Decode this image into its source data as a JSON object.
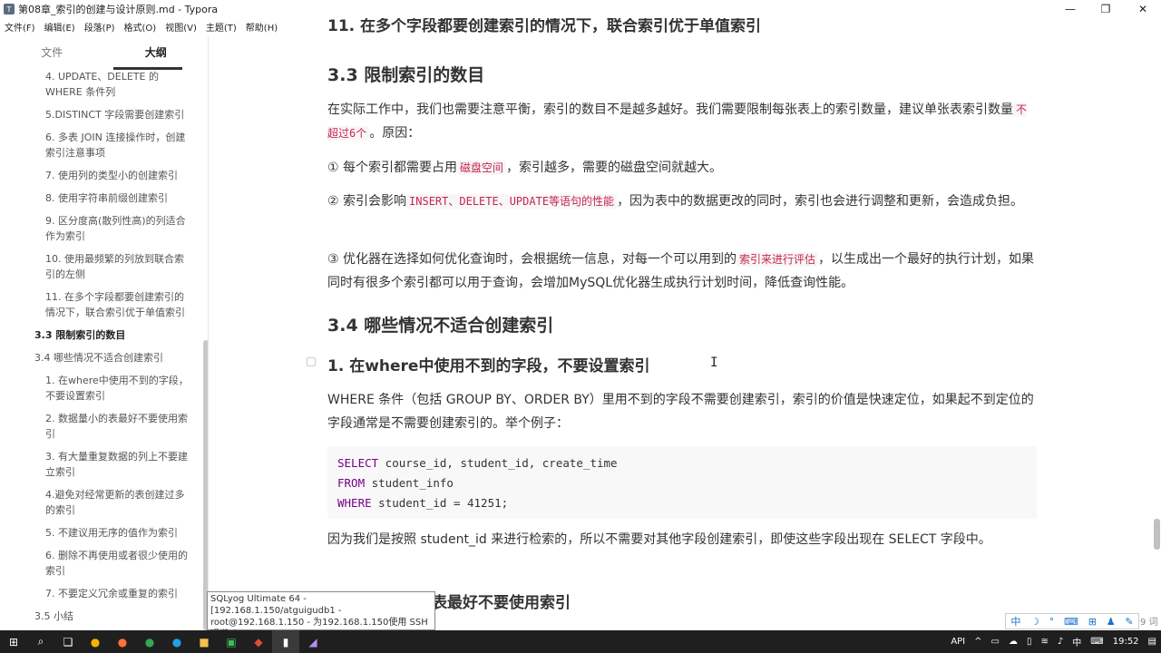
{
  "window": {
    "title": "第08章_索引的创建与设计原则.md - Typora",
    "controls": {
      "minimize": "—",
      "maximize": "❐",
      "close": "✕"
    }
  },
  "menu": [
    "文件(F)",
    "编辑(E)",
    "段落(P)",
    "格式(O)",
    "视图(V)",
    "主题(T)",
    "帮助(H)"
  ],
  "sidebar": {
    "tabs": [
      "文件",
      "大纲"
    ],
    "items": [
      {
        "text": "4. UPDATE、DELETE 的 WHERE 条件列",
        "level": 3,
        "bold": false
      },
      {
        "text": "5.DISTINCT 字段需要创建索引",
        "level": 3,
        "bold": false
      },
      {
        "text": "6. 多表 JOIN 连接操作时，创建索引注意事项",
        "level": 3,
        "bold": false
      },
      {
        "text": "7. 使用列的类型小的创建索引",
        "level": 3,
        "bold": false
      },
      {
        "text": "8. 使用字符串前缀创建索引",
        "level": 3,
        "bold": false
      },
      {
        "text": "9. 区分度高(散列性高)的列适合作为索引",
        "level": 3,
        "bold": false
      },
      {
        "text": "10. 使用最频繁的列放到联合索引的左侧",
        "level": 3,
        "bold": false
      },
      {
        "text": "11. 在多个字段都要创建索引的情况下，联合索引优于单值索引",
        "level": 3,
        "bold": false
      },
      {
        "text": "3.3 限制索引的数目",
        "level": 2,
        "bold": true
      },
      {
        "text": "3.4 哪些情况不适合创建索引",
        "level": 2,
        "bold": false
      },
      {
        "text": "1. 在where中使用不到的字段，不要设置索引",
        "level": 3,
        "bold": false
      },
      {
        "text": "2. 数据量小的表最好不要使用索引",
        "level": 3,
        "bold": false
      },
      {
        "text": "3. 有大量重复数据的列上不要建立索引",
        "level": 3,
        "bold": false
      },
      {
        "text": "4.避免对经常更新的表创建过多的索引",
        "level": 3,
        "bold": false
      },
      {
        "text": "5. 不建议用无序的值作为索引",
        "level": 3,
        "bold": false
      },
      {
        "text": "6. 删除不再使用或者很少使用的索引",
        "level": 3,
        "bold": false
      },
      {
        "text": "7. 不要定义冗余或重复的索引",
        "level": 3,
        "bold": false
      },
      {
        "text": "3.5 小结",
        "level": 2,
        "bold": false
      }
    ]
  },
  "doc": {
    "cut_heading": "11. 在多个字段都要创建索引的情况下，联合索引优于单值索引",
    "h_33": "3.3 限制索引的数目",
    "p1_a": "在实际工作中，我们也需要注意平衡，索引的数目不是越多越好。我们需要限制每张表上的索引数量，建议单张表索引数量",
    "p1_code": "不超过6个",
    "p1_b": "。原因：",
    "p2_a": "① 每个索引都需要占用",
    "p2_code": "磁盘空间",
    "p2_b": "，索引越多，需要的磁盘空间就越大。",
    "p3_a": "② 索引会影响",
    "p3_code": "INSERT、DELETE、UPDATE等语句的性能",
    "p3_b": "，因为表中的数据更改的同时，索引也会进行调整和更新，会造成负担。",
    "p4_a": "③ 优化器在选择如何优化查询时，会根据统一信息，对每一个可以用到的",
    "p4_code": "索引来进行评估",
    "p4_b": "，以生成出一个最好的执行计划，如果同时有很多个索引都可以用于查询，会增加MySQL优化器生成执行计划时间，降低查询性能。",
    "h_34": "3.4 哪些情况不适合创建索引",
    "h3_1": "1. 在where中使用不到的字段，不要设置索引",
    "p5": "WHERE 条件（包括 GROUP BY、ORDER BY）里用不到的字段不需要创建索引，索引的价值是快速定位，如果起不到定位的字段通常是不需要创建索引的。举个例子：",
    "code": [
      {
        "kw": "SELECT",
        "rest": " course_id, student_id, create_time"
      },
      {
        "kw": "FROM",
        "rest": " student_info"
      },
      {
        "kw": "WHERE",
        "rest": " student_id = 41251;"
      }
    ],
    "p6": "因为我们是按照 student_id 来进行检索的，所以不需要对其他字段创建索引，即使这些字段出现在 SELECT 字段中。",
    "h3_2_visible": "表最好不要使用索引"
  },
  "tooltip": "SQLyog Ultimate 64 - [192.168.1.150/atguigudb1 - root@192.168.1.150 - 为192.168.1.150使用 SSH 通道*]",
  "ime": {
    "items": [
      "中",
      "☽",
      "°",
      "⌨",
      "⊞",
      "♟",
      "✎"
    ],
    "extra": "9 词"
  },
  "taskbar": {
    "api_label": "API",
    "lang": "中",
    "time": "19:52"
  }
}
